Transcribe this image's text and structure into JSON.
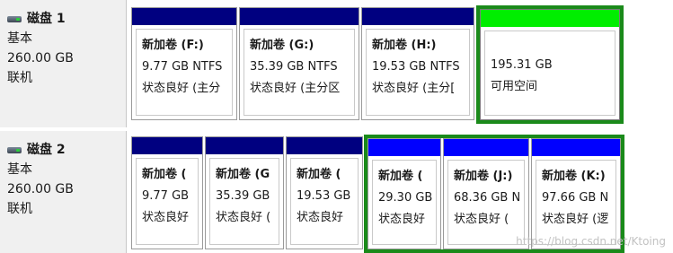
{
  "colors": {
    "primary_bar": "#000080",
    "logical_bar": "#0000ff",
    "free_bar": "#00ee00",
    "selection_frame": "#1a8a1a"
  },
  "disks": [
    {
      "icon": "disk-icon",
      "title": "磁盘 1",
      "type": "基本",
      "size": "260.00 GB",
      "status": "联机",
      "partitions": [
        {
          "kind": "primary",
          "name": "新加卷 (F:)",
          "line2": "9.77 GB NTFS",
          "line3": "状态良好 (主分"
        },
        {
          "kind": "primary",
          "name": "新加卷 (G:)",
          "line2": "35.39 GB NTFS",
          "line3": "状态良好 (主分区"
        },
        {
          "kind": "primary",
          "name": "新加卷 (H:)",
          "line2": "19.53 GB NTFS",
          "line3": "状态良好 (主分["
        },
        {
          "kind": "free",
          "name": "",
          "line2": "195.31 GB",
          "line3": "可用空间"
        }
      ]
    },
    {
      "icon": "disk-icon",
      "title": "磁盘 2",
      "type": "基本",
      "size": "260.00 GB",
      "status": "联机",
      "partitions": [
        {
          "kind": "primary",
          "name": "新加卷 (",
          "line2": "9.77 GB",
          "line3": "状态良好"
        },
        {
          "kind": "primary",
          "name": "新加卷 (G",
          "line2": "35.39 GB",
          "line3": "状态良好 ("
        },
        {
          "kind": "primary",
          "name": "新加卷 (",
          "line2": "19.53 GB",
          "line3": "状态良好"
        },
        {
          "kind": "logical",
          "name": "新加卷 (",
          "line2": "29.30 GB",
          "line3": "状态良好"
        },
        {
          "kind": "logical",
          "name": "新加卷 (J:)",
          "line2": "68.36 GB N",
          "line3": "状态良好 ("
        },
        {
          "kind": "logical",
          "name": "新加卷 (K:)",
          "line2": "97.66 GB N",
          "line3": "状态良好 (逻"
        }
      ]
    }
  ],
  "watermark": "https://blog.csdn.net/Ktoing"
}
